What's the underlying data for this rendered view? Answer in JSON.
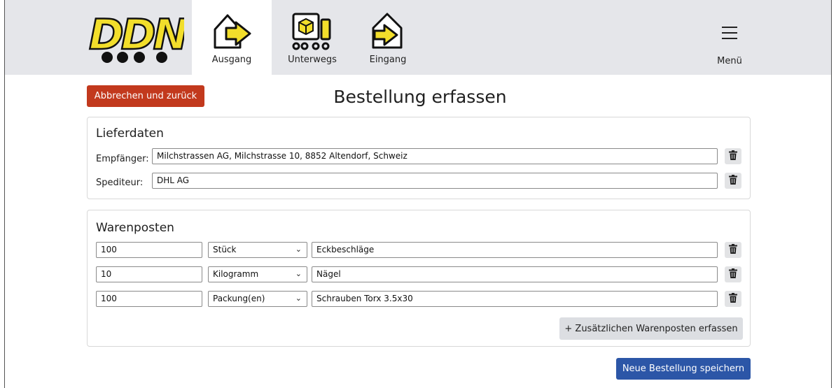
{
  "header": {
    "logo_text": "DDN",
    "nav": [
      {
        "label": "Ausgang",
        "icon": "box-arrow-out-icon",
        "active": true
      },
      {
        "label": "Unterwegs",
        "icon": "truck-box-icon",
        "active": false
      },
      {
        "label": "Eingang",
        "icon": "box-arrow-in-icon",
        "active": false
      }
    ],
    "menu_label": "Menü"
  },
  "actions": {
    "cancel_label": "Abbrechen und zurück",
    "save_label": "Neue Bestellung speichern"
  },
  "page_title": "Bestellung erfassen",
  "lieferdaten": {
    "title": "Lieferdaten",
    "empfaenger_label": "Empfänger:",
    "empfaenger_value": "Milchstrassen AG, Milchstrasse 10, 8852 Altendorf, Schweiz",
    "spediteur_label": "Spediteur:",
    "spediteur_value": "DHL AG"
  },
  "warenposten": {
    "title": "Warenposten",
    "items": [
      {
        "quantity": "100",
        "unit": "Stück",
        "description": "Eckbeschläge"
      },
      {
        "quantity": "10",
        "unit": "Kilogramm",
        "description": "Nägel"
      },
      {
        "quantity": "100",
        "unit": "Packung(en)",
        "description": "Schrauben Torx 3.5x30"
      }
    ],
    "add_label": "+ Zusätzlichen Warenposten erfassen"
  },
  "colors": {
    "cancel": "#c2391d",
    "save": "#2c56a7",
    "logo_yellow": "#f2de2b",
    "topbar": "#e5e6ea"
  }
}
